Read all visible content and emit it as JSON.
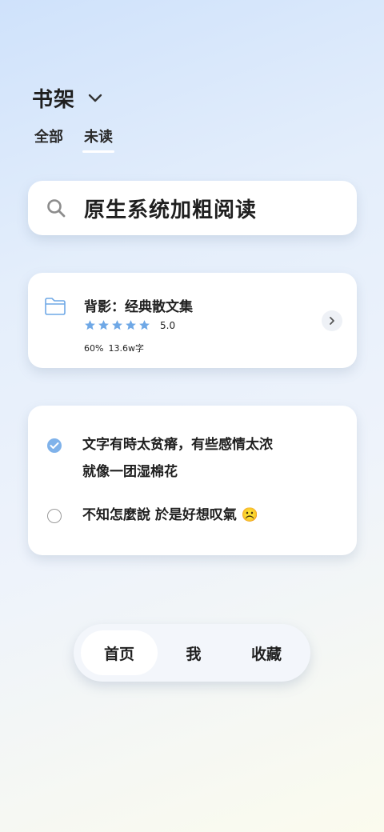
{
  "header": {
    "title": "书架",
    "tabs": [
      {
        "label": "全部"
      },
      {
        "label": "未读"
      }
    ]
  },
  "search": {
    "text": "原生系统加粗阅读"
  },
  "book": {
    "title": "背影：经典散文集",
    "rating": "5.0",
    "star_count": 5,
    "progress": "60%",
    "word_count": "13.6w字"
  },
  "todos": [
    {
      "text_line1": "文字有時太贫瘠，有些感情太浓",
      "text_line2": "就像一团湿棉花",
      "done": true
    },
    {
      "text": "不知怎麼說  於是好想叹氣 ☹️",
      "done": false
    }
  ],
  "nav": {
    "home": "首页",
    "me": "我",
    "favorites": "收藏"
  },
  "colors": {
    "accent": "#7fb2ea",
    "star": "#6fa8e6"
  }
}
